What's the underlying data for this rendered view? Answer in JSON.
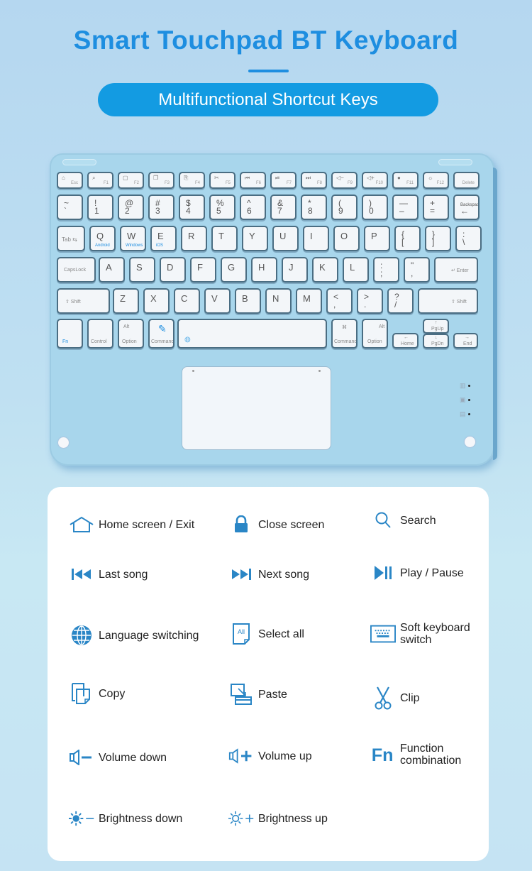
{
  "header": {
    "title": "Smart Touchpad BT Keyboard",
    "subtitle": "Multifunctional Shortcut Keys"
  },
  "colors": {
    "accent": "#1e8ee0",
    "pill": "#139be2",
    "icon": "#2a86c6",
    "keyboard_body": "#a8d6ec"
  },
  "keyboard": {
    "fn_row": [
      {
        "icon": "home-icon",
        "glyph": "⌂",
        "label": "Esc"
      },
      {
        "icon": "search-icon",
        "glyph": "⌕",
        "label": "F1"
      },
      {
        "icon": "select-all-icon",
        "glyph": "▢",
        "label": "F2"
      },
      {
        "icon": "copy-icon",
        "glyph": "❐",
        "label": "F3"
      },
      {
        "icon": "paste-icon",
        "glyph": "⎘",
        "label": "F4"
      },
      {
        "icon": "scissors-icon",
        "glyph": "✂",
        "label": "F5"
      },
      {
        "icon": "previous-track-icon",
        "glyph": "⏮",
        "label": "F6"
      },
      {
        "icon": "play-pause-icon",
        "glyph": "⏯",
        "label": "F7"
      },
      {
        "icon": "next-track-icon",
        "glyph": "⏭",
        "label": "F8"
      },
      {
        "icon": "volume-down-icon",
        "glyph": "◁−",
        "label": "F9"
      },
      {
        "icon": "volume-up-icon",
        "glyph": "◁+",
        "label": "F10"
      },
      {
        "icon": "brightness-down-icon",
        "glyph": "●",
        "label": "F11"
      },
      {
        "icon": "brightness-up-icon",
        "glyph": "☼",
        "label": "F12"
      },
      {
        "icon": "lock-icon",
        "glyph": "",
        "label": "Delete"
      }
    ],
    "number_row": [
      {
        "top": "~",
        "bottom": "`"
      },
      {
        "top": "!",
        "bottom": "1"
      },
      {
        "top": "@",
        "bottom": "2"
      },
      {
        "top": "#",
        "bottom": "3"
      },
      {
        "top": "$",
        "bottom": "4"
      },
      {
        "top": "%",
        "bottom": "5"
      },
      {
        "top": "^",
        "bottom": "6"
      },
      {
        "top": "&",
        "bottom": "7"
      },
      {
        "top": "*",
        "bottom": "8"
      },
      {
        "top": "(",
        "bottom": "9"
      },
      {
        "top": ")",
        "bottom": "0"
      },
      {
        "top": "—",
        "bottom": "–"
      },
      {
        "top": "+",
        "bottom": "="
      },
      {
        "top": "Backspace",
        "bottom": "←"
      }
    ],
    "qwerty_row": [
      {
        "main": "Tab ⇆",
        "sub": ""
      },
      {
        "main": "Q",
        "sub": "Android"
      },
      {
        "main": "W",
        "sub": "Windows"
      },
      {
        "main": "E",
        "sub": "iOS"
      },
      {
        "main": "R",
        "sub": ""
      },
      {
        "main": "T",
        "sub": ""
      },
      {
        "main": "Y",
        "sub": ""
      },
      {
        "main": "U",
        "sub": ""
      },
      {
        "main": "I",
        "sub": ""
      },
      {
        "main": "O",
        "sub": ""
      },
      {
        "main": "P",
        "sub": ""
      },
      {
        "main": "{",
        "sub": "["
      },
      {
        "main": "}",
        "sub": "]"
      },
      {
        "main": ":",
        "sub": "\\"
      }
    ],
    "home_row": [
      "CapsLock",
      "A",
      "S",
      "D",
      "F",
      "G",
      "H",
      "J",
      "K",
      "L",
      ":",
      "\"",
      "↵ Enter"
    ],
    "home_row_sub": [
      "",
      "",
      "",
      "",
      "",
      "",
      "",
      "",
      "",
      "",
      ";",
      ",",
      ""
    ],
    "shift_row": [
      "⇧ Shift",
      "Z",
      "X",
      "C",
      "V",
      "B",
      "N",
      "M",
      "<",
      ">",
      "?",
      "⇧ Shift"
    ],
    "shift_row_sub": [
      "",
      "",
      "",
      "",
      "",
      "",
      "",
      "",
      ",",
      ".",
      "/",
      ""
    ],
    "bottom_row": {
      "fn": "Fn",
      "control": "Control",
      "alt_left_top": "Alt",
      "option_left": "Option",
      "command_left": "Command",
      "command_right": "Command",
      "command_symbol": "⌘",
      "alt_right_top": "Alt",
      "option_right": "Option",
      "home": "Home",
      "pgup": "PgUp",
      "pgdn": "PgDn",
      "end": "End",
      "arrow_left": "←",
      "arrow_up": "↑",
      "arrow_down": "↓",
      "arrow_right": "→"
    },
    "indicators": [
      "battery",
      "bluetooth",
      "charging"
    ]
  },
  "shortcuts": [
    {
      "icon": "home-icon",
      "label": "Home screen / Exit"
    },
    {
      "icon": "lock-icon",
      "label": "Close screen"
    },
    {
      "icon": "search-icon",
      "label": "Search"
    },
    {
      "icon": "previous-track-icon",
      "label": "Last song"
    },
    {
      "icon": "next-track-icon",
      "label": "Next song"
    },
    {
      "icon": "play-pause-icon",
      "label": "Play / Pause"
    },
    {
      "icon": "globe-icon",
      "label": "Language switching"
    },
    {
      "icon": "select-all-icon",
      "label": "Select all",
      "icon_text": "All"
    },
    {
      "icon": "keyboard-icon",
      "label": "Soft keyboard switch"
    },
    {
      "icon": "copy-icon",
      "label": "Copy"
    },
    {
      "icon": "paste-icon",
      "label": "Paste"
    },
    {
      "icon": "scissors-icon",
      "label": "Clip"
    },
    {
      "icon": "volume-down-icon",
      "label": "Volume down"
    },
    {
      "icon": "volume-up-icon",
      "label": "Volume up"
    },
    {
      "icon": "fn-icon",
      "label": "Function combination",
      "icon_text": "Fn"
    },
    {
      "icon": "brightness-down-icon",
      "label": "Brightness down"
    },
    {
      "icon": "brightness-up-icon",
      "label": "Brightness up"
    }
  ]
}
